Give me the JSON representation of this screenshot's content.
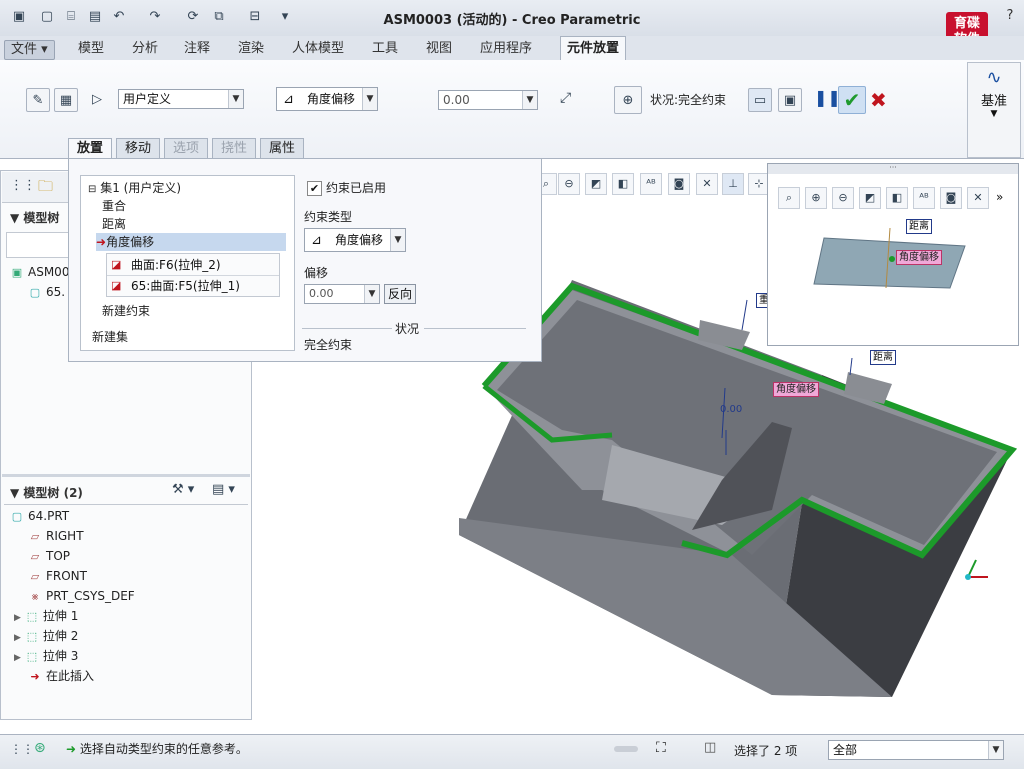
{
  "window": {
    "title": "ASM0003 (活动的) - Creo Parametric",
    "logo_text": "育碟\n软件"
  },
  "tabs": [
    "文件",
    "模型",
    "分析",
    "注释",
    "渲染",
    "人体模型",
    "工具",
    "视图",
    "应用程序",
    "元件放置"
  ],
  "ribbon": {
    "constraint_set_type": "用户定义",
    "constraint_type": "角度偏移",
    "offset_value": "0.00",
    "status_label": "状况:完全约束",
    "datum_label": "基准"
  },
  "dashboard_tabs": [
    "放置",
    "移动",
    "选项",
    "挠性",
    "属性"
  ],
  "placement": {
    "set_label": "集1 (用户定义)",
    "constraints": [
      "重合",
      "距离",
      "角度偏移"
    ],
    "refs": [
      "曲面:F6(拉伸_2)",
      "65:曲面:F5(拉伸_1)"
    ],
    "new_constraint": "新建约束",
    "new_set": "新建集",
    "enabled_label": "约束已启用",
    "type_label": "约束类型",
    "type_value": "角度偏移",
    "offset_label": "偏移",
    "offset_value": "0.00",
    "reverse_btn": "反向",
    "status_label": "状况",
    "status_value": "完全约束"
  },
  "navigator": {
    "upper_title": "模型树",
    "upper_rows": [
      "ASM00",
      "65."
    ],
    "lower_title": "模型树 (2)",
    "tree": [
      "64.PRT",
      "RIGHT",
      "TOP",
      "FRONT",
      "PRT_CSYS_DEF",
      "拉伸 1",
      "拉伸 2",
      "拉伸 3",
      "在此插入"
    ]
  },
  "view_labels": {
    "dist": "距离",
    "angle": "角度偏移",
    "zero": "0.00",
    "coinc": "重合"
  },
  "statusbar": {
    "message": "选择自动类型约束的任意参考。",
    "selected": "选择了 2 项",
    "filter": "全部"
  }
}
